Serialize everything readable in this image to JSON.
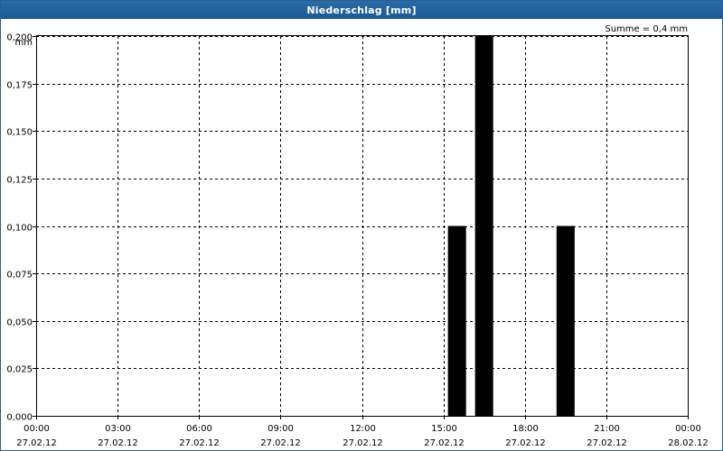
{
  "window": {
    "title": "Niederschlag [mm]"
  },
  "chart_data": {
    "type": "bar",
    "title": "Niederschlag [mm]",
    "ylabel": "mm",
    "xlabel": "",
    "summary": "Summe = 0,4 mm",
    "ylim": [
      0,
      0.2
    ],
    "yticks": [
      "0,000",
      "0,025",
      "0,050",
      "0,075",
      "0,100",
      "0,125",
      "0,150",
      "0,175",
      "0,200"
    ],
    "xlim_hours": [
      0,
      24
    ],
    "xticks": [
      {
        "time": "00:00",
        "date": "27.02.12"
      },
      {
        "time": "03:00",
        "date": "27.02.12"
      },
      {
        "time": "06:00",
        "date": "27.02.12"
      },
      {
        "time": "09:00",
        "date": "27.02.12"
      },
      {
        "time": "12:00",
        "date": "27.02.12"
      },
      {
        "time": "15:00",
        "date": "27.02.12"
      },
      {
        "time": "18:00",
        "date": "27.02.12"
      },
      {
        "time": "21:00",
        "date": "27.02.12"
      },
      {
        "time": "00:00",
        "date": "28.02.12"
      }
    ],
    "bars": [
      {
        "start": "27.02.12 15:10",
        "end": "27.02.12 15:50",
        "value": 0.1
      },
      {
        "start": "27.02.12 16:10",
        "end": "27.02.12 16:50",
        "value": 0.2
      },
      {
        "start": "27.02.12 19:10",
        "end": "27.02.12 19:50",
        "value": 0.1
      }
    ],
    "grid": true,
    "bar_color": "#000000"
  }
}
